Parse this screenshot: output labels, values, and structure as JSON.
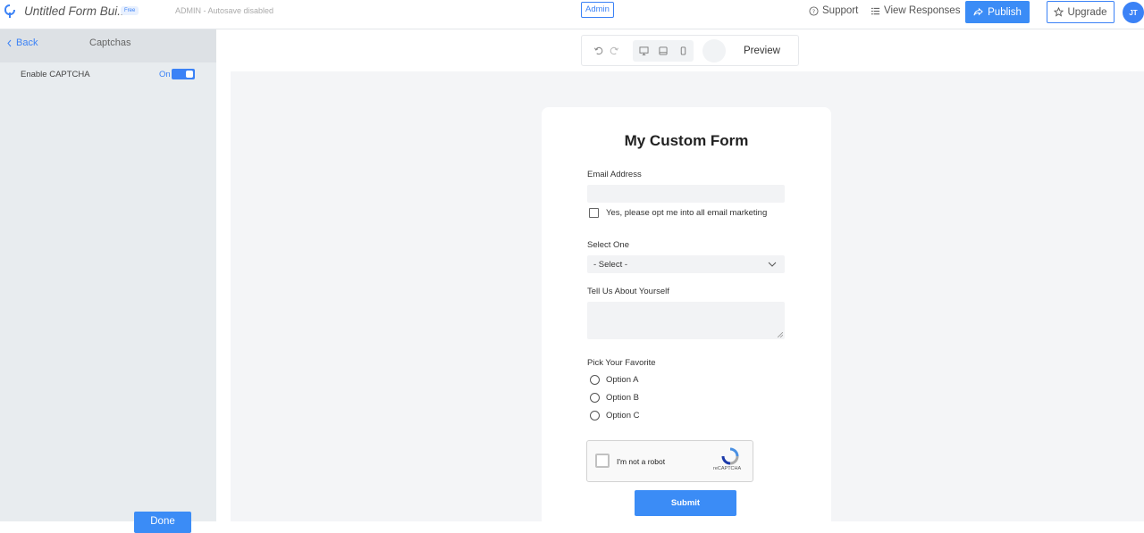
{
  "topbar": {
    "app_title": "Untitled Form Bui...",
    "plan_badge": "Free",
    "admin_note": "ADMIN - Autosave disabled",
    "admin_badge": "Admin",
    "support_label": "Support",
    "view_responses_label": "View Responses",
    "publish_label": "Publish",
    "upgrade_label": "Upgrade",
    "avatar_initials": "JT"
  },
  "sidebar": {
    "back_label": "Back",
    "title": "Captchas",
    "enable_captcha_label": "Enable CAPTCHA",
    "toggle_state_label": "On",
    "toggle_on": true,
    "done_label": "Done"
  },
  "toolbar": {
    "undo_icon": "undo-icon",
    "redo_icon": "redo-icon",
    "devices": [
      "desktop-icon",
      "tablet-icon",
      "mobile-icon"
    ],
    "preview_label": "Preview"
  },
  "form": {
    "title": "My Custom Form",
    "email_label": "Email Address",
    "optin_label": "Yes, please opt me into all email marketing",
    "select_label": "Select One",
    "select_value": "- Select -",
    "textarea_label": "Tell Us About Yourself",
    "radio_label": "Pick Your Favorite",
    "radio_options": [
      "Option A",
      "Option B",
      "Option C"
    ],
    "captcha_text": "I'm not a robot",
    "captcha_brand": "reCAPTCHA",
    "submit_label": "Submit"
  },
  "colors": {
    "accent": "#3b8cf6",
    "sidebar_bg": "#e8ecef",
    "canvas_bg": "#f4f5f7"
  }
}
